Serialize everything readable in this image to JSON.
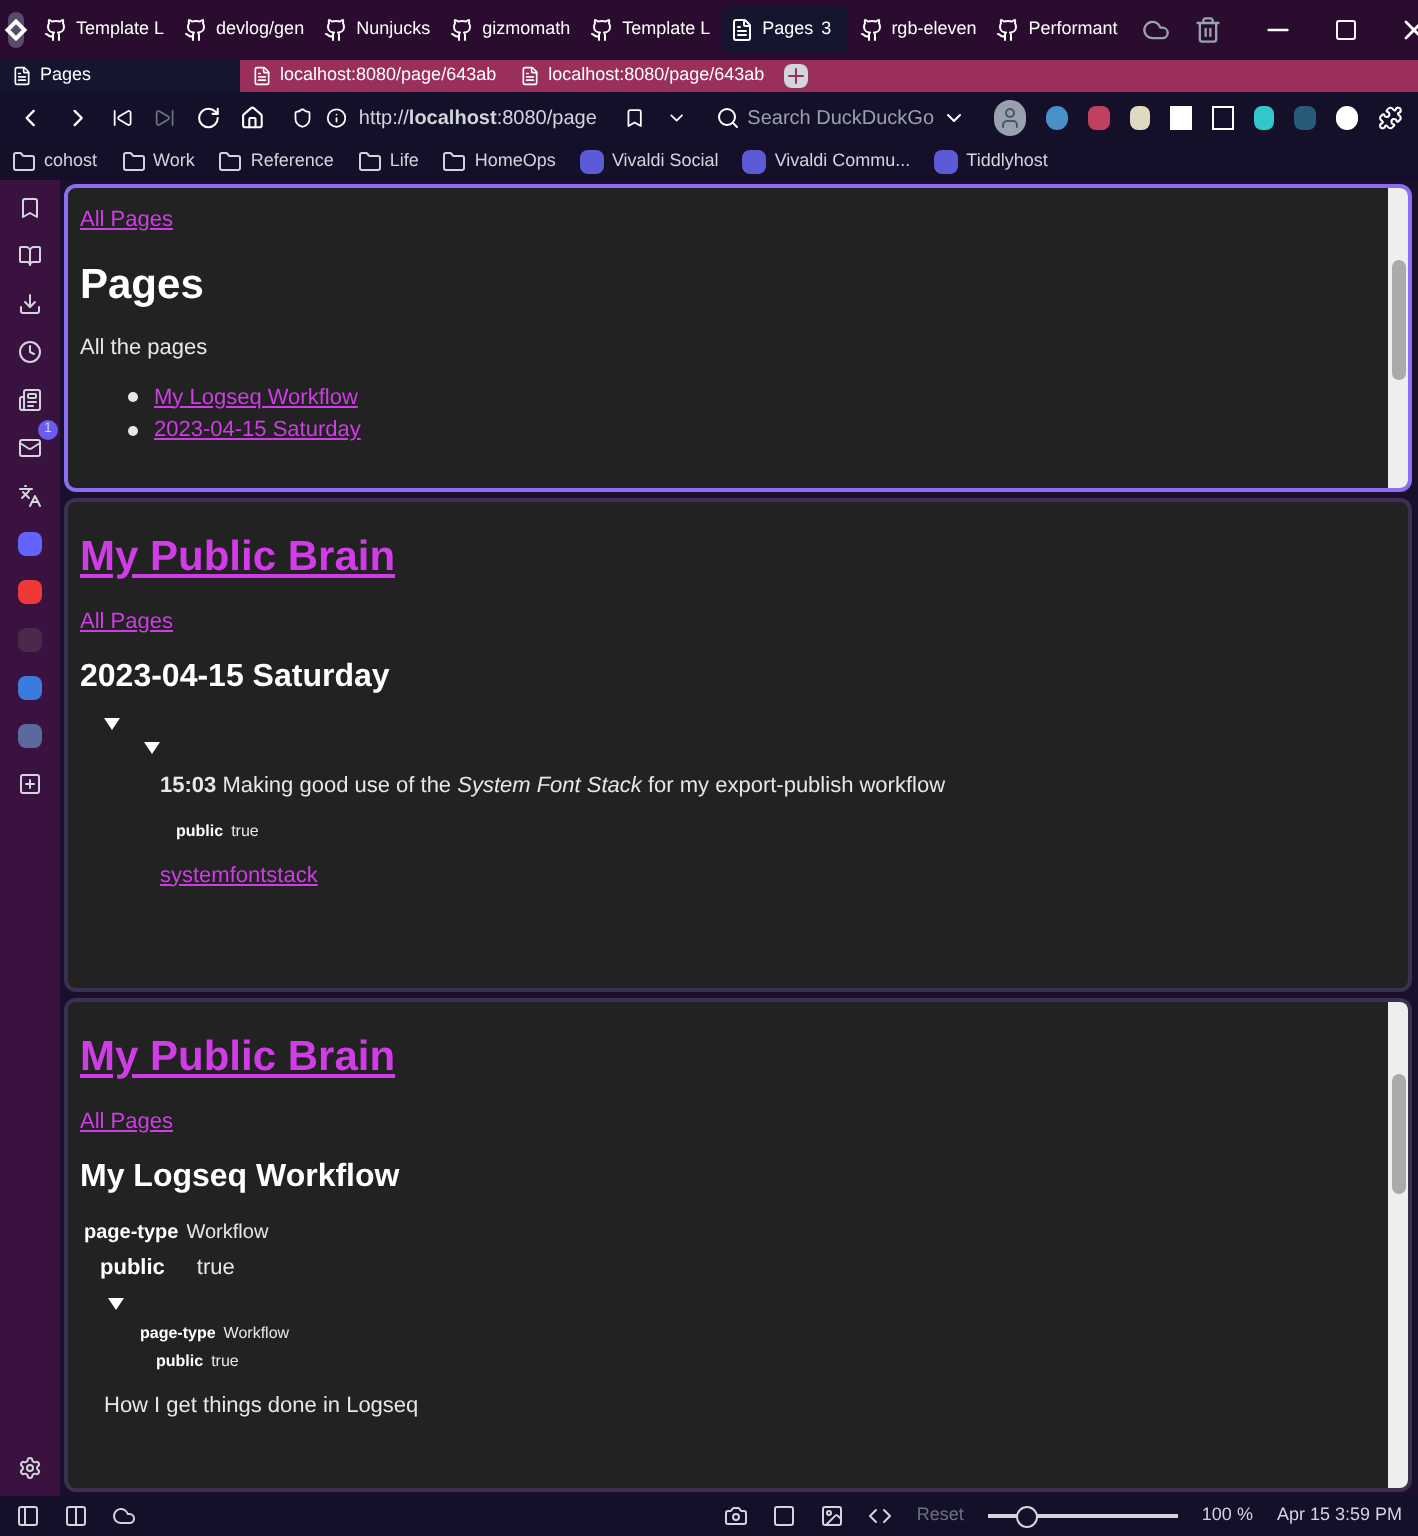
{
  "tab_bar": {
    "tabs": [
      {
        "title": "Template L",
        "selected": false
      },
      {
        "title": "devlog/gen",
        "selected": false
      },
      {
        "title": "Nunjucks",
        "selected": false
      },
      {
        "title": "gizmomath",
        "selected": false
      },
      {
        "title": "Template L",
        "selected": false
      },
      {
        "title": "Pages",
        "count": "3",
        "selected": true
      },
      {
        "title": "rgb-eleven",
        "selected": false
      },
      {
        "title": "Performant",
        "selected": false
      }
    ]
  },
  "tab_stack": {
    "tabs": [
      {
        "title": "Pages",
        "selected": true
      },
      {
        "title": "localhost:8080/page/643ab",
        "selected": false
      },
      {
        "title": "localhost:8080/page/643ab",
        "selected": false
      }
    ]
  },
  "address_bar": {
    "url": "http://**localhost**:8080/page",
    "search_placeholder": "Search DuckDuckGo"
  },
  "bookmarks": [
    {
      "label": "cohost",
      "kind": "folder"
    },
    {
      "label": "Work",
      "kind": "folder"
    },
    {
      "label": "Reference",
      "kind": "folder"
    },
    {
      "label": "Life",
      "kind": "folder"
    },
    {
      "label": "HomeOps",
      "kind": "folder"
    },
    {
      "label": "Vivaldi Social",
      "kind": "site"
    },
    {
      "label": "Vivaldi Commu...",
      "kind": "site"
    },
    {
      "label": "Tiddlyhost",
      "kind": "site"
    }
  ],
  "side_panel": {
    "badge": "1"
  },
  "panels": [
    {
      "focused": true,
      "blocks": [
        {
          "kind": "link",
          "text": "All Pages"
        },
        {
          "kind": "title",
          "text": "Pages"
        },
        {
          "kind": "text",
          "text": "All the pages"
        },
        {
          "kind": "list",
          "items": [
            "My Logseq Workflow",
            "2023-04-15 Saturday"
          ]
        }
      ]
    },
    {
      "focused": false,
      "blocks": [
        {
          "kind": "site_title",
          "text": "My Public Brain"
        },
        {
          "kind": "link",
          "text": "All Pages"
        },
        {
          "kind": "heading",
          "text": "2023-04-15 Saturday"
        },
        {
          "kind": "toggle",
          "children": [
            {
              "kind": "toggle",
              "children": [
                {
                  "kind": "entry",
                  "text": "**15:03** Making good use of the *System Font Stack* for my export-publish workflow"
                },
                {
                  "kind": "prop_small",
                  "key": "public",
                  "value": "true"
                },
                {
                  "kind": "link",
                  "text": "systemfontstack"
                }
              ]
            }
          ]
        }
      ]
    },
    {
      "focused": false,
      "blocks": [
        {
          "kind": "site_title",
          "text": "My Public Brain"
        },
        {
          "kind": "link",
          "text": "All Pages"
        },
        {
          "kind": "heading",
          "text": "My Logseq Workflow"
        },
        {
          "kind": "prop",
          "key": "page-type",
          "value": "Workflow",
          "children": [
            {
              "kind": "prop_large",
              "key": "public",
              "value": "true"
            },
            {
              "kind": "toggle",
              "children": [
                {
                  "kind": "prop_small",
                  "key": "page-type",
                  "value": "Workflow",
                  "children": [
                    {
                      "kind": "prop_small",
                      "key": "public",
                      "value": "true"
                    }
                  ]
                }
              ]
            }
          ]
        },
        {
          "kind": "note",
          "text": "How I get things done in Logseq"
        }
      ]
    }
  ],
  "status_bar": {
    "reset": "Reset",
    "zoom_slider": {
      "level": 0.2
    },
    "zoom": "100 %",
    "clock": "Apr 15 3:59 PM"
  }
}
